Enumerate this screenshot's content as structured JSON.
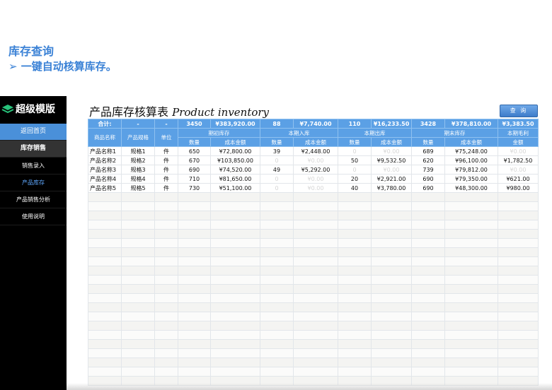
{
  "heading": {
    "title": "库存查询",
    "subtitle": "➢ 一键自动核算库存。"
  },
  "sidebar": {
    "brand": "超级模版",
    "items": [
      {
        "label": "返回首页",
        "kind": "home"
      },
      {
        "label": "库存销售",
        "kind": "section"
      },
      {
        "label": "销售录入",
        "kind": "item"
      },
      {
        "label": "产品库存",
        "kind": "active"
      },
      {
        "label": "产品销售分析",
        "kind": "item"
      },
      {
        "label": "使用说明",
        "kind": "item"
      }
    ]
  },
  "page": {
    "title_cn": "产品库存核算表",
    "title_en": "Product inventory",
    "query_button": "查 询"
  },
  "table": {
    "totals": [
      "合计:",
      "-",
      "-",
      "3450",
      "¥383,920.00",
      "88",
      "¥7,740.00",
      "110",
      "¥16,233.50",
      "3428",
      "¥378,810.00",
      "¥3,383.50"
    ],
    "groups": [
      "期初库存",
      "本期入库",
      "本期出库",
      "期末库存",
      "本期毛利"
    ],
    "fixed_headers": [
      "商品名称",
      "产品规格",
      "单位"
    ],
    "sub_headers": [
      "数量",
      "成本金额",
      "数量",
      "成本金额",
      "数量",
      "成本金额",
      "数量",
      "成本金额",
      "金额"
    ],
    "rows": [
      [
        "产品名称1",
        "规格1",
        "件",
        "650",
        "¥72,800.00",
        "39",
        "¥2,448.00",
        "0",
        "¥0.00",
        "689",
        "¥75,248.00",
        "¥0.00"
      ],
      [
        "产品名称2",
        "规格2",
        "件",
        "670",
        "¥103,850.00",
        "0",
        "¥0.00",
        "50",
        "¥9,532.50",
        "620",
        "¥96,100.00",
        "¥1,782.50"
      ],
      [
        "产品名称3",
        "规格3",
        "件",
        "690",
        "¥74,520.00",
        "49",
        "¥5,292.00",
        "0",
        "¥0.00",
        "739",
        "¥79,812.00",
        "¥0.00"
      ],
      [
        "产品名称4",
        "规格4",
        "件",
        "710",
        "¥81,650.00",
        "0",
        "¥0.00",
        "20",
        "¥2,921.00",
        "690",
        "¥79,350.00",
        "¥621.00"
      ],
      [
        "产品名称5",
        "规格5",
        "件",
        "730",
        "¥51,100.00",
        "0",
        "¥0.00",
        "40",
        "¥3,780.00",
        "690",
        "¥48,300.00",
        "¥980.00"
      ]
    ],
    "empty_rows": 21
  }
}
